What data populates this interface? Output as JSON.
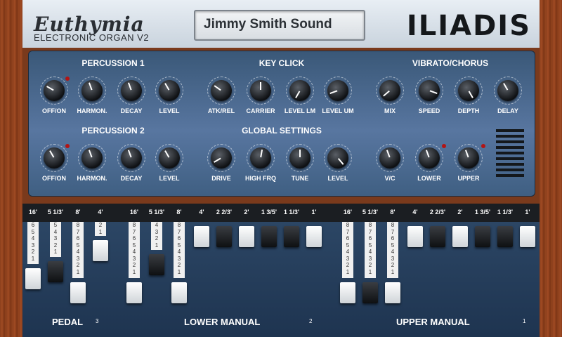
{
  "header": {
    "brand": "Euthymia",
    "subtitle": "ELECTRONIC ORGAN V2",
    "preset": "Jimmy Smith Sound",
    "logo": "ILIADIS"
  },
  "sections": {
    "percussion1": "PERCUSSION 1",
    "key_click": "KEY CLICK",
    "vibrato": "VIBRATO/CHORUS",
    "percussion2": "PERCUSSION 2",
    "global": "GLOBAL SETTINGS"
  },
  "knobs": {
    "row1": [
      {
        "label": "OFF/ON",
        "angle": -60
      },
      {
        "label": "HARMON.",
        "angle": -20
      },
      {
        "label": "DECAY",
        "angle": -20
      },
      {
        "label": "LEVEL",
        "angle": -30
      },
      {
        "label": "ATK/REL",
        "angle": -55
      },
      {
        "label": "CARRIER",
        "angle": 0
      },
      {
        "label": "LEVEL LM",
        "angle": -150
      },
      {
        "label": "LEVEL UM",
        "angle": -110
      },
      {
        "label": "MIX",
        "angle": -130
      },
      {
        "label": "SPEED",
        "angle": 110
      },
      {
        "label": "DEPTH",
        "angle": 150
      },
      {
        "label": "DELAY",
        "angle": -30
      }
    ],
    "row2": [
      {
        "label": "OFF/ON",
        "angle": -30
      },
      {
        "label": "HARMON.",
        "angle": -20
      },
      {
        "label": "DECAY",
        "angle": -20
      },
      {
        "label": "LEVEL",
        "angle": -30
      },
      {
        "label": "DRIVE",
        "angle": -120
      },
      {
        "label": "HIGH FRQ",
        "angle": 10
      },
      {
        "label": "TUNE",
        "angle": 0
      },
      {
        "label": "LEVEL",
        "angle": 140
      },
      {
        "label": "V/C",
        "angle": -20
      },
      {
        "label": "LOWER",
        "angle": -20
      },
      {
        "label": "UPPER",
        "angle": -20
      }
    ]
  },
  "pedal": {
    "title": "PEDAL",
    "midi": "3",
    "bars": [
      {
        "label": "16'",
        "value": 6,
        "color": "white",
        "nums": [
          "6",
          "5",
          "4",
          "3",
          "2",
          "1"
        ]
      },
      {
        "label": "5 1/3'",
        "value": 5,
        "color": "black",
        "nums": [
          "5",
          "4",
          "3",
          "2",
          "1"
        ]
      },
      {
        "label": "8'",
        "value": 8,
        "color": "white",
        "nums": [
          "8",
          "7",
          "6",
          "5",
          "4",
          "3",
          "2",
          "1"
        ]
      },
      {
        "label": "4'",
        "value": 2,
        "color": "white",
        "nums": [
          "2",
          "1"
        ]
      }
    ]
  },
  "lower": {
    "title": "LOWER MANUAL",
    "midi": "2",
    "bars": [
      {
        "label": "16'",
        "value": 8,
        "color": "white",
        "nums": [
          "8",
          "7",
          "6",
          "5",
          "4",
          "3",
          "2",
          "1"
        ]
      },
      {
        "label": "5 1/3'",
        "value": 4,
        "color": "black",
        "nums": [
          "4",
          "3",
          "2",
          "1"
        ]
      },
      {
        "label": "8'",
        "value": 8,
        "color": "white",
        "nums": [
          "8",
          "7",
          "6",
          "5",
          "4",
          "3",
          "2",
          "1"
        ]
      },
      {
        "label": "4'",
        "value": 0,
        "color": "white",
        "nums": []
      },
      {
        "label": "2 2/3'",
        "value": 0,
        "color": "black",
        "nums": []
      },
      {
        "label": "2'",
        "value": 0,
        "color": "white",
        "nums": []
      },
      {
        "label": "1 3/5'",
        "value": 0,
        "color": "black",
        "nums": []
      },
      {
        "label": "1 1/3'",
        "value": 0,
        "color": "black",
        "nums": []
      },
      {
        "label": "1'",
        "value": 0,
        "color": "white",
        "nums": []
      }
    ]
  },
  "upper": {
    "title": "UPPER MANUAL",
    "midi": "1",
    "bars": [
      {
        "label": "16'",
        "value": 8,
        "color": "white",
        "nums": [
          "8",
          "7",
          "6",
          "5",
          "4",
          "3",
          "2",
          "1"
        ]
      },
      {
        "label": "5 1/3'",
        "value": 8,
        "color": "black",
        "nums": [
          "8",
          "7",
          "6",
          "5",
          "4",
          "3",
          "2",
          "1"
        ]
      },
      {
        "label": "8'",
        "value": 8,
        "color": "white",
        "nums": [
          "8",
          "7",
          "6",
          "5",
          "4",
          "3",
          "2",
          "1"
        ]
      },
      {
        "label": "4'",
        "value": 0,
        "color": "white",
        "nums": []
      },
      {
        "label": "2 2/3'",
        "value": 0,
        "color": "black",
        "nums": []
      },
      {
        "label": "2'",
        "value": 0,
        "color": "white",
        "nums": []
      },
      {
        "label": "1 3/5'",
        "value": 0,
        "color": "black",
        "nums": []
      },
      {
        "label": "1 1/3'",
        "value": 0,
        "color": "black",
        "nums": []
      },
      {
        "label": "1'",
        "value": 0,
        "color": "white",
        "nums": []
      }
    ]
  }
}
